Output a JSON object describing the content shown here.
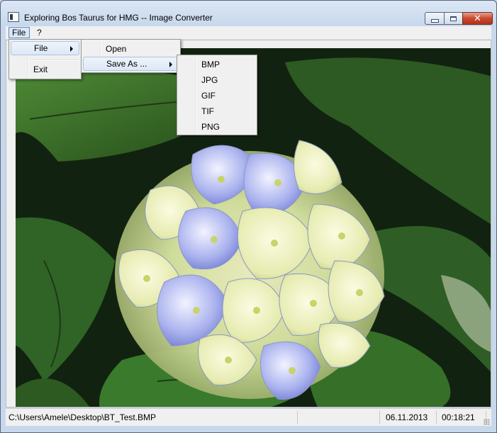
{
  "window": {
    "title": "Exploring Bos Taurus for HMG  -- Image Converter",
    "close_glyph": "✕"
  },
  "menubar": {
    "items": [
      {
        "label": "File"
      },
      {
        "label": "?"
      }
    ]
  },
  "file_menu": {
    "items": [
      {
        "label": "File",
        "has_submenu": true
      },
      {
        "label": "Exit"
      }
    ]
  },
  "file_submenu": {
    "items": [
      {
        "label": "Open"
      },
      {
        "label": "Save As ...",
        "has_submenu": true
      }
    ]
  },
  "save_as_menu": {
    "items": [
      {
        "label": "BMP"
      },
      {
        "label": "JPG"
      },
      {
        "label": "GIF"
      },
      {
        "label": "TIF"
      },
      {
        "label": "PNG"
      }
    ]
  },
  "image": {
    "subject": "hydrangea flower photo",
    "colors": {
      "leaves": "#2f5a23",
      "dark": "#0f1d0c",
      "petal_blue": "#8e98e6",
      "petal_cream": "#eef0b8"
    }
  },
  "statusbar": {
    "path": "C:\\Users\\Amele\\Desktop\\BT_Test.BMP",
    "date": "06.11.2013",
    "time": "00:18:21"
  }
}
